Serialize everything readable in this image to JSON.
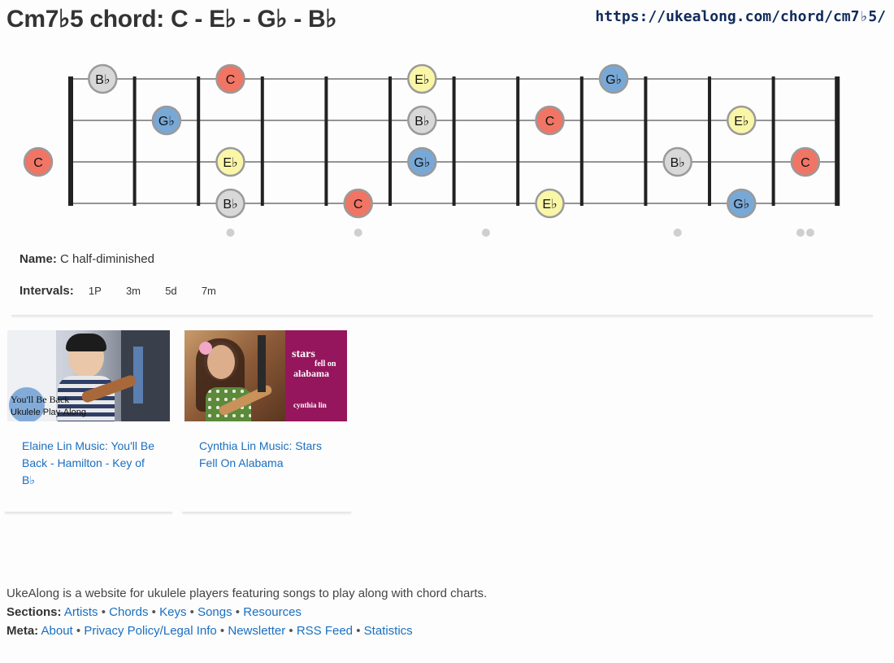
{
  "header": {
    "title": "Cm7♭5 chord: C - E♭ - G♭ - B♭",
    "url": "https://ukealong.com/chord/cm7♭5/"
  },
  "fretboard": {
    "strings": 4,
    "frets": 12,
    "fret_markers": [
      3,
      5,
      7,
      10
    ],
    "double_marker_fret": 12,
    "note_colors": {
      "C": "#f07565",
      "E♭": "#faf6a8",
      "G♭": "#78a8d6",
      "B♭": "#d8d8d8"
    },
    "notes": [
      {
        "string": 0,
        "fret": 1,
        "label": "B♭"
      },
      {
        "string": 0,
        "fret": 3,
        "label": "C"
      },
      {
        "string": 0,
        "fret": 6,
        "label": "E♭"
      },
      {
        "string": 0,
        "fret": 9,
        "label": "G♭"
      },
      {
        "string": 1,
        "fret": 2,
        "label": "G♭"
      },
      {
        "string": 1,
        "fret": 6,
        "label": "B♭"
      },
      {
        "string": 1,
        "fret": 8,
        "label": "C"
      },
      {
        "string": 1,
        "fret": 11,
        "label": "E♭"
      },
      {
        "string": 2,
        "fret": 0,
        "label": "C"
      },
      {
        "string": 2,
        "fret": 3,
        "label": "E♭"
      },
      {
        "string": 2,
        "fret": 6,
        "label": "G♭"
      },
      {
        "string": 2,
        "fret": 10,
        "label": "B♭"
      },
      {
        "string": 2,
        "fret": 12,
        "label": "C"
      },
      {
        "string": 3,
        "fret": 3,
        "label": "B♭"
      },
      {
        "string": 3,
        "fret": 5,
        "label": "C"
      },
      {
        "string": 3,
        "fret": 8,
        "label": "E♭"
      },
      {
        "string": 3,
        "fret": 11,
        "label": "G♭"
      }
    ]
  },
  "info": {
    "name_label": "Name:",
    "name_value": "C half-diminished",
    "intervals_label": "Intervals:",
    "intervals": [
      "1P",
      "3m",
      "5d",
      "7m"
    ]
  },
  "videos": [
    {
      "link": "Elaine Lin Music: You'll Be Back - Hamilton - Key of B♭",
      "thumb_line1": "You'll Be Back",
      "thumb_line2": "Ukulele Play-Along"
    },
    {
      "link": "Cynthia Lin Music: Stars Fell On Alabama",
      "thumb_title1": "stars",
      "thumb_title2": "fell on",
      "thumb_title3": "alabama",
      "thumb_artist": "cynthia lin",
      "thumb_bg": "#96165e"
    }
  ],
  "footer": {
    "description": "UkeAlong is a website for ukulele players featuring songs to play along with chord charts.",
    "sections_label": "Sections:",
    "sections": [
      "Artists",
      "Chords",
      "Keys",
      "Songs",
      "Resources"
    ],
    "meta_label": "Meta:",
    "meta": [
      "About",
      "Privacy Policy/Legal Info",
      "Newsletter",
      "RSS Feed",
      "Statistics"
    ],
    "separator": "•"
  }
}
